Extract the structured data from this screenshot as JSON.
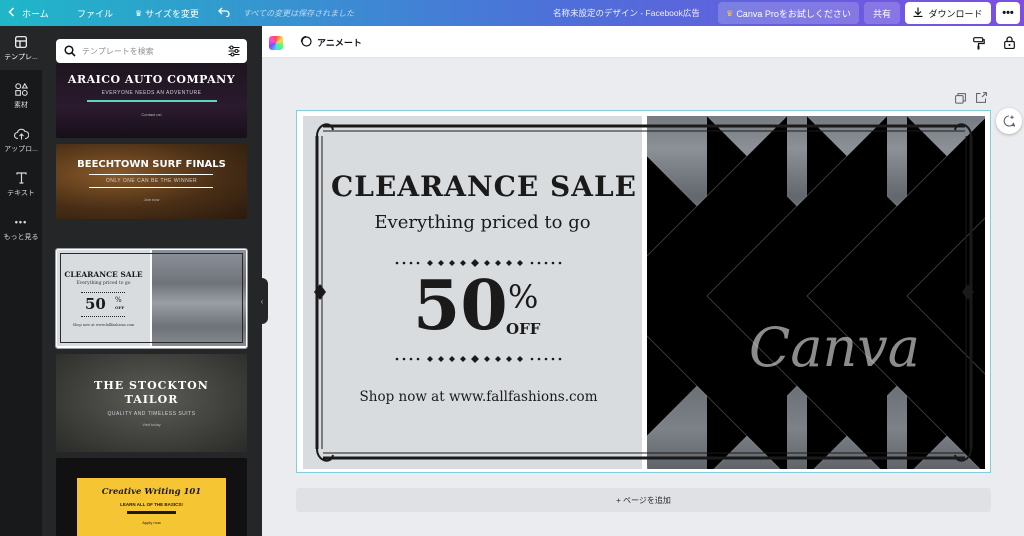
{
  "topbar": {
    "back_icon": "chevron-left-icon",
    "home": "ホーム",
    "file": "ファイル",
    "resize": "サイズを変更",
    "resize_icon": "crown-icon",
    "undo_icon": "undo-icon",
    "save_status": "すべての変更は保存されました",
    "doc_title": "名称未設定のデザイン - Facebook広告",
    "try_pro": "Canva Proをお試しください",
    "try_pro_icon": "crown-icon",
    "share": "共有",
    "download": "ダウンロード",
    "download_icon": "download-icon",
    "more_icon": "more-horizontal-icon"
  },
  "rail": {
    "items": [
      {
        "label": "テンプレ...",
        "icon": "template-icon"
      },
      {
        "label": "素材",
        "icon": "elements-icon"
      },
      {
        "label": "アップロ...",
        "icon": "upload-cloud-icon"
      },
      {
        "label": "テキスト",
        "icon": "text-icon"
      },
      {
        "label": "もっと見る",
        "icon": "more-dots-icon"
      }
    ]
  },
  "panel": {
    "search_placeholder": "テンプレートを検索",
    "search_icon": "search-icon",
    "filter_icon": "filter-sliders-icon",
    "collapse_icon": "chevron-left-icon",
    "templates": [
      {
        "title": "ARAICO AUTO COMPANY",
        "subtitle": "EVERYONE NEEDS AN ADVENTURE",
        "footer": "Contact us!"
      },
      {
        "title": "BEECHTOWN SURF FINALS",
        "subtitle": "ONLY ONE CAN BE THE WINNER",
        "footer": "Join now"
      },
      {
        "title": "CLEARANCE SALE",
        "subtitle": "Everything priced to go",
        "big": "50",
        "percent": "%",
        "off": "OFF",
        "footer": "Shop now at www.fallfashions.com"
      },
      {
        "title": "THE STOCKTON TAILOR",
        "subtitle": "QUALITY AND TIMELESS SUITS",
        "footer": "Visit today"
      },
      {
        "title": "Creative Writing 101",
        "subtitle": "LEARN ALL OF THE BASICS!",
        "footer": "Apply now"
      }
    ]
  },
  "toolbar": {
    "color_icon": "color-palette-icon",
    "animate_icon": "animate-icon",
    "animate": "アニメート",
    "paint_icon": "paint-roller-icon",
    "lock_icon": "lock-icon"
  },
  "canvas_actions": {
    "duplicate_icon": "duplicate-page-icon",
    "add_icon": "add-page-icon",
    "comment_icon": "comment-add-icon"
  },
  "design": {
    "title": "CLEARANCE SALE",
    "subtitle": "Everything priced to go",
    "big_number": "50",
    "percent": "%",
    "off": "OFF",
    "shop": "Shop now at www.fallfashions.com",
    "watermark": "Canva"
  },
  "add_page": "+ ページを追加",
  "colors": {
    "gradient_start": "#1fb7c8",
    "gradient_end": "#7c4ee3",
    "rail_bg": "#18191b",
    "panel_bg": "#252627",
    "canvas_selection": "#7fd0dc",
    "design_left_bg": "#d9dcdf"
  }
}
